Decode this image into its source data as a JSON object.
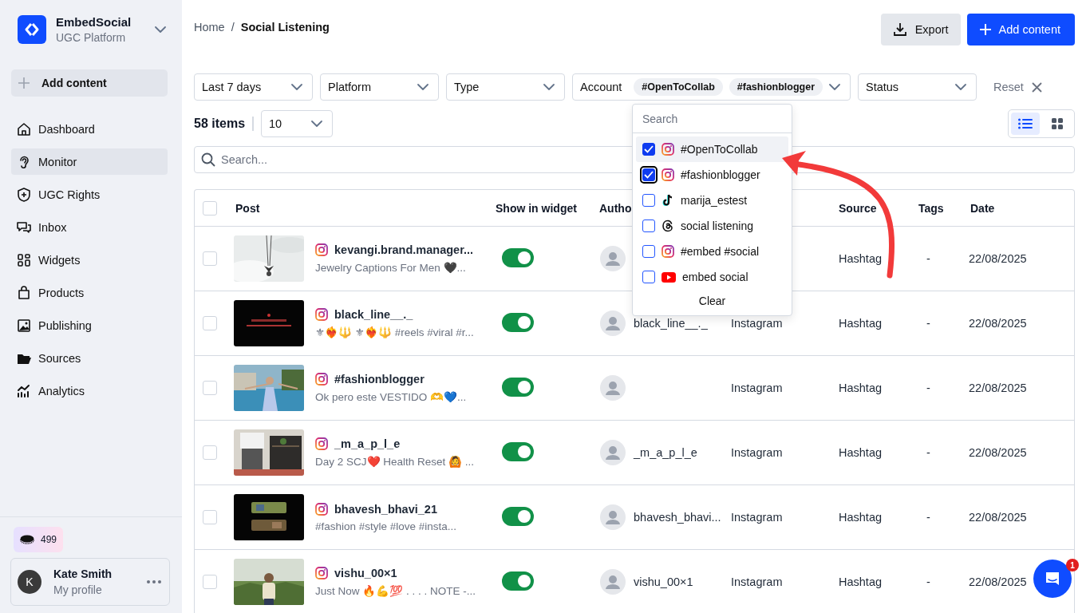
{
  "sidebar": {
    "brand": {
      "name": "EmbedSocial",
      "subtitle": "UGC Platform"
    },
    "add_button": "Add content",
    "items": [
      {
        "label": "Dashboard",
        "selected": false
      },
      {
        "label": "Monitor",
        "selected": true
      },
      {
        "label": "UGC Rights",
        "selected": false
      },
      {
        "label": "Inbox",
        "selected": false
      },
      {
        "label": "Widgets",
        "selected": false
      },
      {
        "label": "Products",
        "selected": false
      },
      {
        "label": "Publishing",
        "selected": false
      },
      {
        "label": "Sources",
        "selected": false
      },
      {
        "label": "Analytics",
        "selected": false
      }
    ],
    "credits": "499",
    "user": {
      "initial": "K",
      "name": "Kate Smith",
      "subtitle": "My profile"
    }
  },
  "breadcrumb": {
    "items": [
      "Home",
      "Social Listening"
    ],
    "separator": "/"
  },
  "header_buttons": {
    "export": "Export",
    "add": "Add content"
  },
  "filters": [
    {
      "label": "Last 7 days"
    },
    {
      "label": "Platform"
    },
    {
      "label": "Type"
    },
    {
      "label": "Account",
      "chips": [
        "#OpenToCollab",
        "#fashionblogger"
      ]
    },
    {
      "label": "Status"
    }
  ],
  "reset": "Reset",
  "items_count": "58 items",
  "per_page": "10",
  "view_toggle": [
    {
      "kind": "list",
      "selected": true
    },
    {
      "kind": "grid",
      "selected": false
    }
  ],
  "search": {
    "placeholder": "Search..."
  },
  "account_dropdown": {
    "search_placeholder": "Search",
    "options": [
      {
        "label": "#OpenToCollab",
        "kind": "instagram",
        "checked": true,
        "highlighted": true,
        "focused": false
      },
      {
        "label": "#fashionblogger",
        "kind": "instagram",
        "checked": true,
        "highlighted": false,
        "focused": true
      },
      {
        "label": "marija_estest",
        "kind": "tiktok",
        "checked": false,
        "highlighted": false,
        "focused": false
      },
      {
        "label": "social listening",
        "kind": "threads",
        "checked": false,
        "highlighted": false,
        "focused": false
      },
      {
        "label": "#embed #social",
        "kind": "instagram",
        "checked": false,
        "highlighted": false,
        "focused": false
      },
      {
        "label": "embed social",
        "kind": "youtube",
        "checked": false,
        "highlighted": false,
        "focused": false
      }
    ],
    "clear": "Clear"
  },
  "table": {
    "select_all_checked": false,
    "headers": {
      "post": "Post",
      "show_in_widget": "Show in widget",
      "author": "Autho",
      "source": "Source",
      "tags": "Tags",
      "date": "Date"
    },
    "rows": [
      {
        "title": "kevangi.brand.manager...",
        "caption": "Jewelry Captions For Men 🖤...",
        "checked": false,
        "show_in_widget": true,
        "source": "Hashtag",
        "tags": "-",
        "date": "22/08/2025"
      },
      {
        "title": "black_line__._",
        "caption": "⚜❤️‍🔥🔱 ⚜❤️‍🔥🔱 #reels #viral #r...",
        "checked": false,
        "show_in_widget": true,
        "author": "black_line__._",
        "platform": "Instagram",
        "source": "Hashtag",
        "tags": "-",
        "date": "22/08/2025"
      },
      {
        "title": "#fashionblogger",
        "caption": "Ok pero este VESTIDO 🫶💙...",
        "checked": false,
        "show_in_widget": true,
        "platform": "Instagram",
        "source": "Hashtag",
        "tags": "-",
        "date": "22/08/2025"
      },
      {
        "title": "_m_a_p_l_e",
        "caption": "Day 2 SCJ❤️ Health Reset 🙆 ...",
        "checked": false,
        "show_in_widget": true,
        "author": "_m_a_p_l_e",
        "platform": "Instagram",
        "source": "Hashtag",
        "tags": "-",
        "date": "22/08/2025"
      },
      {
        "title": "bhavesh_bhavi_21",
        "caption": "#fashion #style #love #insta...",
        "checked": false,
        "show_in_widget": true,
        "author": "bhavesh_bhavi...",
        "platform": "Instagram",
        "source": "Hashtag",
        "tags": "-",
        "date": "22/08/2025"
      },
      {
        "title": "vishu_00×1",
        "caption": "Just Now 🔥💪💯 . . . . NOTE -...",
        "checked": false,
        "show_in_widget": true,
        "author": "vishu_00×1",
        "platform": "Instagram",
        "source": "Hashtag",
        "tags": "-",
        "date": "22/08/2025"
      }
    ]
  },
  "chat": {
    "badge": "1"
  }
}
